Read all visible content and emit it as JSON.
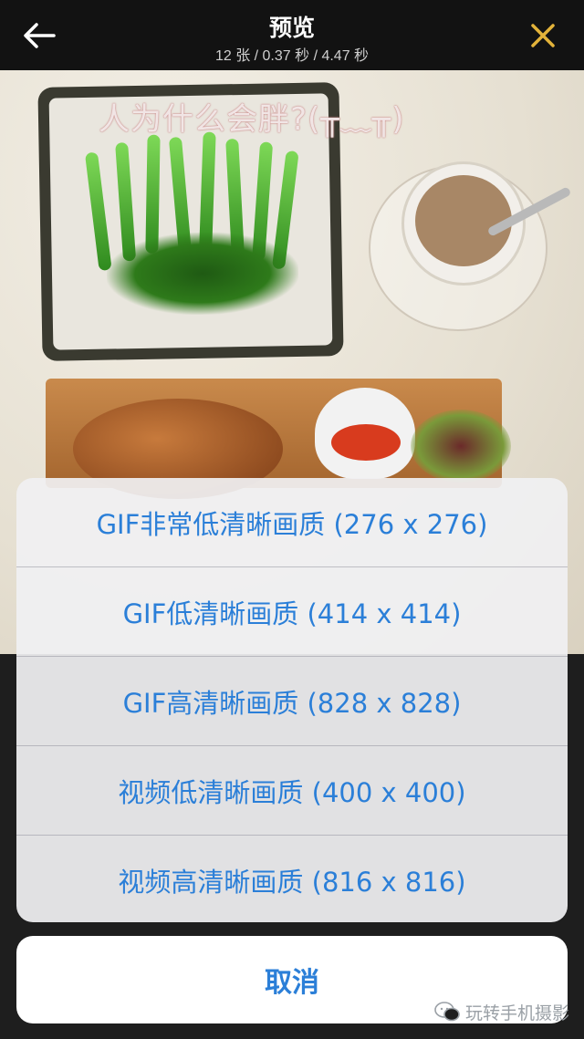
{
  "header": {
    "title": "预览",
    "subtitle": "12 张 / 0.37 秒 / 4.47 秒",
    "back_icon": "arrow-left-icon",
    "close_icon": "close-icon",
    "close_color": "#e3b33a"
  },
  "preview": {
    "caption": "人为什么会胖?(╥﹏╥)"
  },
  "action_sheet": {
    "options": [
      {
        "label": "GIF非常低清晰画质 (276 x 276)"
      },
      {
        "label": "GIF低清晰画质 (414 x 414)"
      },
      {
        "label": "GIF高清晰画质 (828 x 828)"
      },
      {
        "label": "视频低清晰画质 (400 x 400)"
      },
      {
        "label": "视频高清晰画质 (816 x 816)"
      }
    ],
    "cancel_label": "取消",
    "accent_color": "#2b7fd8"
  },
  "watermark": {
    "text": "玩转手机摄影",
    "icon": "wechat-icon"
  }
}
